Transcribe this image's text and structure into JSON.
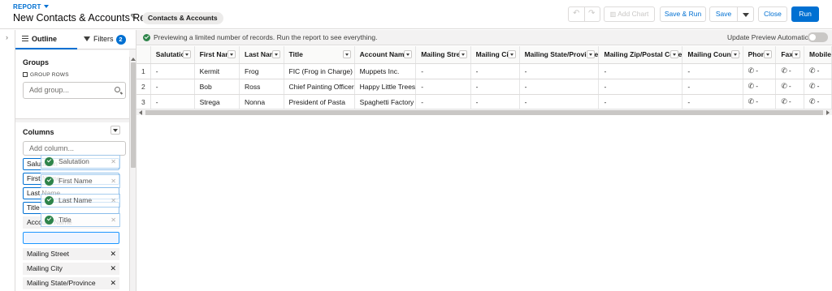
{
  "header": {
    "eyebrow": "REPORT",
    "title": "New Contacts & Accounts Report",
    "report_type": "Contacts & Accounts",
    "buttons": {
      "add_chart": "Add Chart",
      "save_run": "Save & Run",
      "save": "Save",
      "close": "Close",
      "run": "Run"
    }
  },
  "sidebar": {
    "tabs": {
      "outline": "Outline",
      "filters": "Filters",
      "filters_count": "2"
    },
    "groups": {
      "title": "Groups",
      "sub_label": "GROUP ROWS",
      "placeholder": "Add group..."
    },
    "columns": {
      "title": "Columns",
      "placeholder": "Add column...",
      "items": [
        "Salutation",
        "First Name",
        "Last Name",
        "Title",
        "Account Name",
        "Mailing Street",
        "Mailing City",
        "Mailing State/Province"
      ],
      "drag_items": [
        "Salutation",
        "First Name",
        "Last Name",
        "Title"
      ]
    }
  },
  "preview": {
    "notice": "Previewing a limited number of records. Run the report to see everything.",
    "auto_update_label": "Update Preview Automatically",
    "auto_update_on": false,
    "columns": [
      "Salutation",
      "First Name",
      "Last Name",
      "Title",
      "Account Name",
      "Mailing Street",
      "Mailing City",
      "Mailing State/Province",
      "Mailing Zip/Postal Code",
      "Mailing Country",
      "Phone",
      "Fax",
      "Mobile"
    ],
    "rows": [
      {
        "n": "1",
        "cells": [
          "-",
          "Kermit",
          "Frog",
          "FIC (Frog in Charge)",
          "Muppets Inc.",
          "-",
          "-",
          "-",
          "-",
          "-",
          "-",
          "-",
          "-"
        ]
      },
      {
        "n": "2",
        "cells": [
          "-",
          "Bob",
          "Ross",
          "Chief Painting Officer",
          "Happy Little Trees",
          "-",
          "-",
          "-",
          "-",
          "-",
          "-",
          "-",
          "-"
        ]
      },
      {
        "n": "3",
        "cells": [
          "-",
          "Strega",
          "Nonna",
          "President of Pasta",
          "Spaghetti Factory",
          "-",
          "-",
          "-",
          "-",
          "-",
          "-",
          "-",
          "-"
        ]
      }
    ]
  },
  "colors": {
    "brand": "#0070d2",
    "success": "#2e844a",
    "border": "#dddbda"
  }
}
